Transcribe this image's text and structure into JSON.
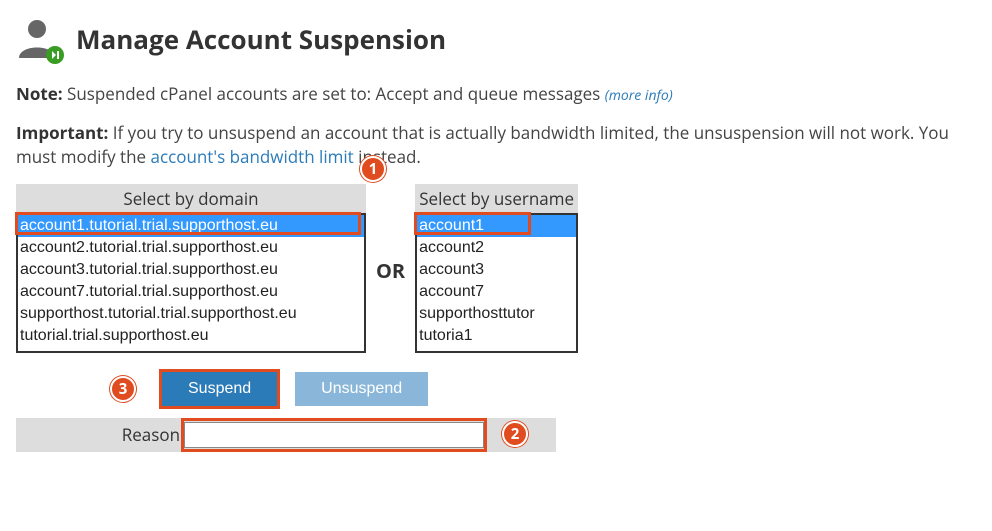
{
  "header": {
    "title": "Manage Account Suspension"
  },
  "note": {
    "label": "Note:",
    "text": "Suspended cPanel accounts are set to: Accept and queue messages",
    "more_info": "(more info)"
  },
  "important": {
    "label": "Important:",
    "text_before": "If you try to unsuspend an account that is actually bandwidth limited, the unsuspension will not work. You must modify the ",
    "link_text": "account's bandwidth limit",
    "text_after": " instead."
  },
  "selectors": {
    "domain_header": "Select by domain",
    "user_header": "Select by username",
    "or_label": "OR",
    "domains": [
      "account1.tutorial.trial.supporthost.eu",
      "account2.tutorial.trial.supporthost.eu",
      "account3.tutorial.trial.supporthost.eu",
      "account7.tutorial.trial.supporthost.eu",
      "supporthost.tutorial.trial.supporthost.eu",
      "tutorial.trial.supporthost.eu"
    ],
    "domain_selected_index": 0,
    "users": [
      "account1",
      "account2",
      "account3",
      "account7",
      "supporthosttutor",
      "tutoria1"
    ],
    "user_selected_index": 0
  },
  "buttons": {
    "suspend": "Suspend",
    "unsuspend": "Unsuspend"
  },
  "reason": {
    "label": "Reason",
    "value": ""
  },
  "callouts": {
    "one": "1",
    "two": "2",
    "three": "3"
  }
}
